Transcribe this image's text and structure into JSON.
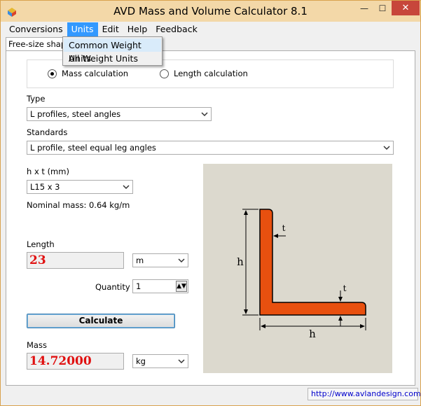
{
  "window": {
    "title": "AVD Mass and Volume Calculator 8.1",
    "minimize": "—",
    "maximize": "☐",
    "close": "✕"
  },
  "menubar": {
    "items": [
      "Conversions",
      "Units",
      "Edit",
      "Help",
      "Feedback"
    ],
    "active": "Units"
  },
  "tab": {
    "label": "Free-size shape"
  },
  "units_menu": {
    "items": [
      "Common Weight Units",
      "All Weight Units"
    ]
  },
  "calc_mode": {
    "mass": "Mass calculation",
    "length": "Length calculation",
    "selected": "mass"
  },
  "type": {
    "label": "Type",
    "value": "L profiles, steel angles"
  },
  "standards": {
    "label": "Standards",
    "value": "L profile, steel equal leg angles"
  },
  "dimension": {
    "label": "h x t (mm)",
    "value": "L15 x 3",
    "nominal_mass": "Nominal mass: 0.64 kg/m"
  },
  "length": {
    "label": "Length",
    "value": "23",
    "unit": "m"
  },
  "quantity": {
    "label": "Quantity",
    "value": "1"
  },
  "calculate_label": "Calculate",
  "mass": {
    "label": "Mass",
    "value": "14.72000",
    "unit": "kg"
  },
  "diagram": {
    "label_h_vertical": "h",
    "label_h_horizontal": "h",
    "label_t_top": "t",
    "label_t_right": "t",
    "profile_color": "#e8500f",
    "background_color": "#dcd9ce"
  },
  "status": {
    "link": "http://www.avlandesign.com"
  }
}
